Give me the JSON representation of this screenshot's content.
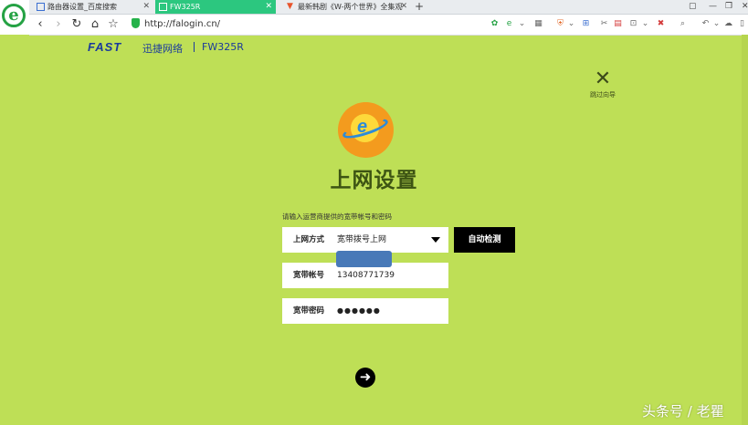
{
  "browser": {
    "tabs": [
      {
        "title": "路由器设置_百度搜索",
        "active": false
      },
      {
        "title": "FW325R",
        "active": true
      },
      {
        "title": "最新韩剧《W-两个世界》全集观",
        "active": false
      }
    ],
    "url": "http://falogin.cn/",
    "accent_color": "#2cc77f"
  },
  "header": {
    "brand": "FAST",
    "brand_cn": "迅捷网络",
    "separator": "|",
    "model": "FW325R",
    "skip_label": "跳过向导"
  },
  "main": {
    "title": "上网设置",
    "hint": "请输入运营商提供的宽带帐号和密码",
    "connection_type": {
      "label": "上网方式",
      "value": "宽带拨号上网"
    },
    "auto_detect_label": "自动检测",
    "account": {
      "label": "宽带帐号",
      "value": "13408771739"
    },
    "password": {
      "label": "宽带密码",
      "value": "●●●●●●"
    },
    "next_icon": "arrow-right-circle-icon",
    "background_color": "#bedf56"
  },
  "watermark": "头条号 / 老瞿"
}
